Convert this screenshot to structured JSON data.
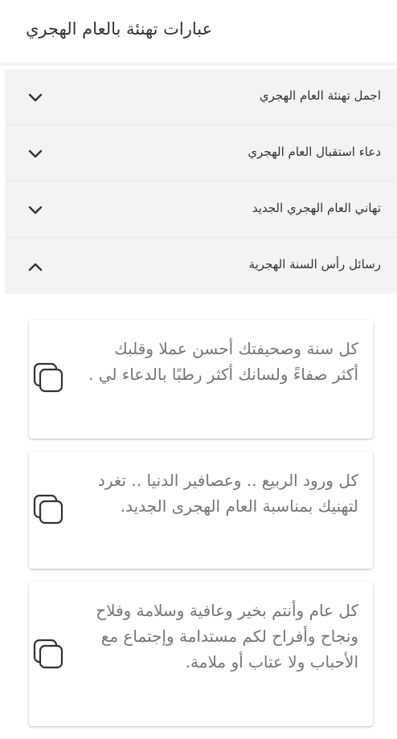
{
  "header": {
    "title": "عبارات تهنئة بالعام الهجري"
  },
  "accordion": {
    "items": [
      {
        "label": "اجمل تهنئة العام الهجري",
        "expanded": false,
        "icon": "chevron-down-icon"
      },
      {
        "label": "دعاء استقبال العام الهجري",
        "expanded": false,
        "icon": "chevron-down-icon"
      },
      {
        "label": "تهاني العام الهجري الجديد",
        "expanded": false,
        "icon": "chevron-down-icon"
      },
      {
        "label": "رسائل رأس السنة الهجرية",
        "expanded": true,
        "icon": "chevron-up-icon"
      }
    ]
  },
  "messages": [
    {
      "text": "كل سنة وصحيفتك أحسن عملا وقلبك أكثر صفاءً ولسانك أكثر رطبًا بالدعاء لي .",
      "icon": "copy-icon"
    },
    {
      "text": "كل ورود الربيع .. وعصافير الدنيا .. تغرد لتهنيك بمناسبة العام الهجرى الجديد.",
      "icon": "copy-icon"
    },
    {
      "text": "كل عام وأنتم بخير وعافية وسلامة وفلاح ونجاح وأفراح لكم مستدامة وإجتماع مع الأحباب ولا عتاب أو ملامة.",
      "icon": "copy-icon"
    }
  ],
  "colors": {
    "accordion_bg": "#f1f3f4",
    "message_text": "#757575",
    "icon": "#333333"
  }
}
